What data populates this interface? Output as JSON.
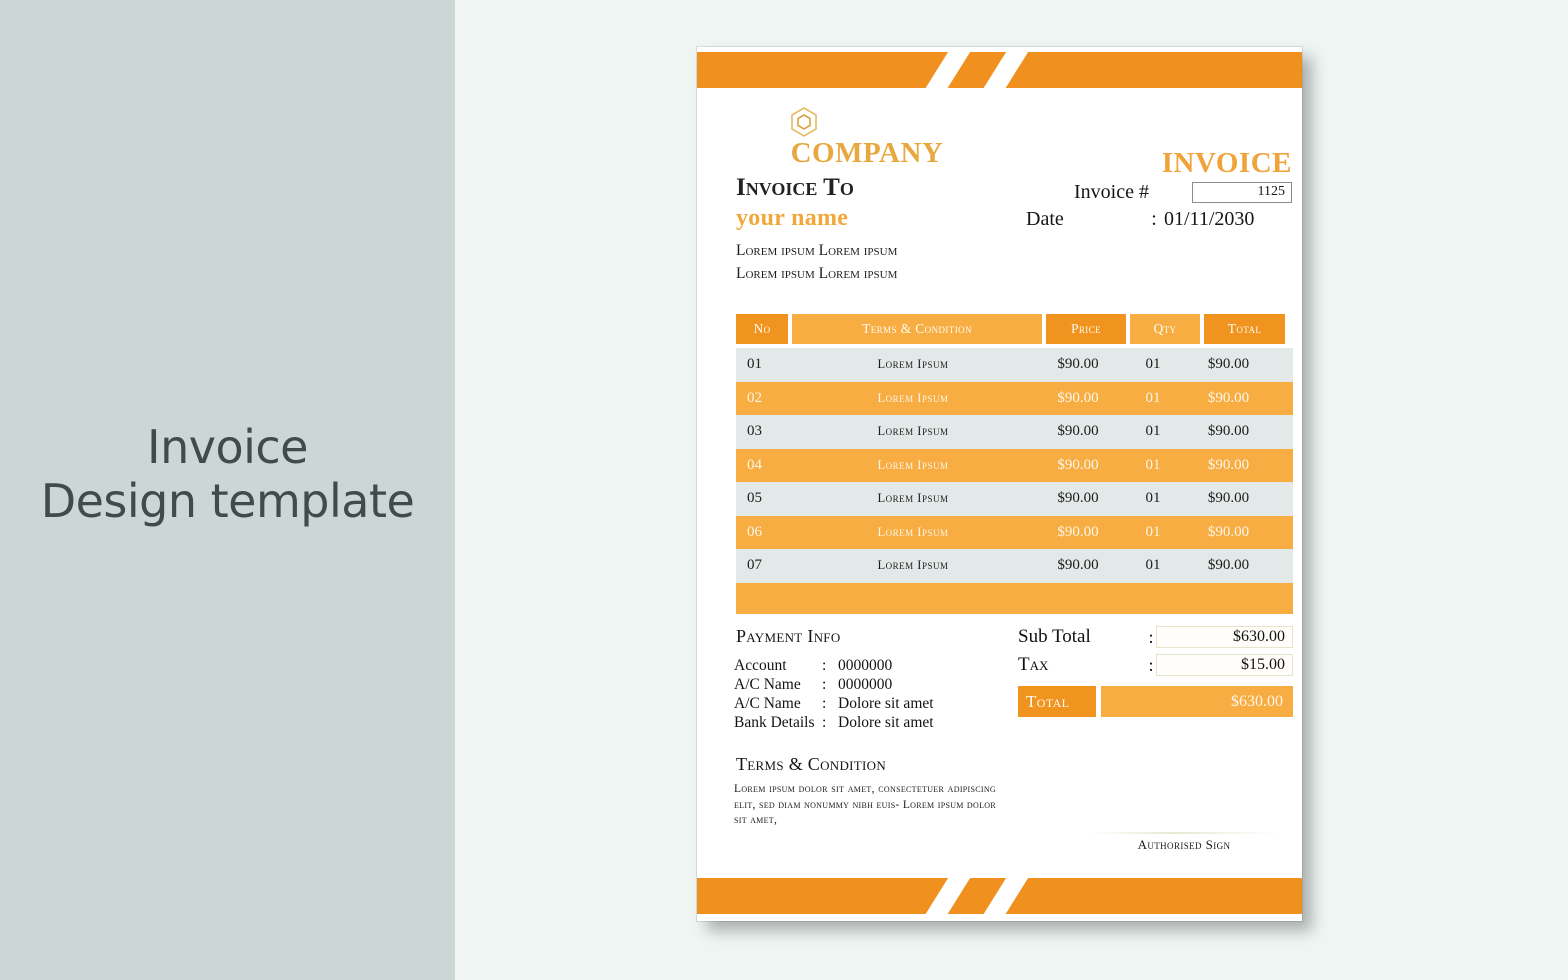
{
  "promo": {
    "line1": "Invoice",
    "line2": "Design template"
  },
  "colors": {
    "orange_dark": "#f0931f",
    "orange_light": "#f7ad42",
    "brand_gold": "#e8a840",
    "row_light": "#e3e9e8",
    "bg_left": "#ccd6d4",
    "bg_right": "#eef5f3"
  },
  "header": {
    "logo_icon": "hexagon-logo-icon",
    "company": "COMPANY",
    "invoice_to_label": "Invoice To",
    "client_name": "your name",
    "address_line1": "Lorem ipsum Lorem ipsum",
    "address_line2": "Lorem ipsum Lorem ipsum",
    "invoice_word": "INVOICE",
    "invoice_no_label": "Invoice #",
    "invoice_no_value": "1125",
    "date_label": "Date",
    "date_colon": ":",
    "date_value": "01/11/2030"
  },
  "table": {
    "columns": [
      "No",
      "Terms & Condition",
      "Price",
      "Qty",
      "Total"
    ],
    "rows": [
      {
        "no": "01",
        "desc": "Lorem Ipsum",
        "price": "$90.00",
        "qty": "01",
        "total": "$90.00"
      },
      {
        "no": "02",
        "desc": "Lorem Ipsum",
        "price": "$90.00",
        "qty": "01",
        "total": "$90.00"
      },
      {
        "no": "03",
        "desc": "Lorem Ipsum",
        "price": "$90.00",
        "qty": "01",
        "total": "$90.00"
      },
      {
        "no": "04",
        "desc": "Lorem Ipsum",
        "price": "$90.00",
        "qty": "01",
        "total": "$90.00"
      },
      {
        "no": "05",
        "desc": "Lorem Ipsum",
        "price": "$90.00",
        "qty": "01",
        "total": "$90.00"
      },
      {
        "no": "06",
        "desc": "Lorem Ipsum",
        "price": "$90.00",
        "qty": "01",
        "total": "$90.00"
      },
      {
        "no": "07",
        "desc": "Lorem Ipsum",
        "price": "$90.00",
        "qty": "01",
        "total": "$90.00"
      }
    ]
  },
  "payment": {
    "title": "Payment Info",
    "rows": [
      {
        "key": "Account",
        "colon": ":",
        "value": "0000000"
      },
      {
        "key": "A/C Name",
        "colon": ":",
        "value": "0000000"
      },
      {
        "key": "A/C Name",
        "colon": ":",
        "value": "Dolore sit amet"
      },
      {
        "key": "Bank Details",
        "colon": ":",
        "value": "Dolore sit amet"
      }
    ]
  },
  "totals": {
    "subtotal_label": "Sub Total",
    "subtotal_colon": ":",
    "subtotal_value": "$630.00",
    "tax_label": "Tax",
    "tax_colon": ":",
    "tax_value": "$15.00",
    "total_label": "Total",
    "total_value": "$630.00"
  },
  "terms": {
    "title": "Terms & Condition",
    "body": "Lorem ipsum dolor sit amet, consectetuer adipiscing elit, sed diam nonummy nibh euis- Lorem ipsum dolor sit amet,",
    "sign_label": "Authorised Sign"
  }
}
